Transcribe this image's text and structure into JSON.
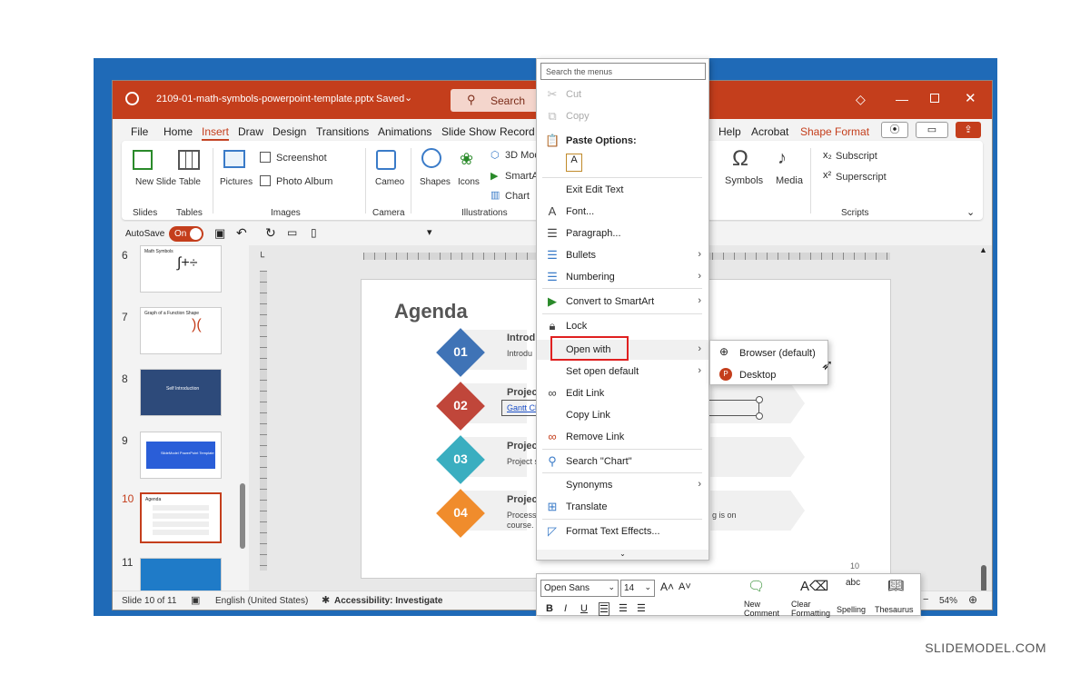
{
  "window": {
    "filename": "2109-01-math-symbols-powerpoint-template.pptx",
    "saved": "Saved",
    "search_label": "Search"
  },
  "tabs": [
    "File",
    "Home",
    "Insert",
    "Draw",
    "Design",
    "Transitions",
    "Animations",
    "Slide Show",
    "Record",
    "Help",
    "Acrobat",
    "Shape Format"
  ],
  "active_tab": "Insert",
  "ribbon": {
    "new_slide": "New Slide",
    "table": "Table",
    "pictures": "Pictures",
    "screenshot": "Screenshot",
    "photo_album": "Photo Album",
    "cameo": "Cameo",
    "shapes": "Shapes",
    "icons": "Icons",
    "models_3d": "3D Model",
    "smartart": "SmartArt",
    "chart": "Chart",
    "symbols": "Symbols",
    "media": "Media",
    "subscript": "Subscript",
    "superscript": "Superscript",
    "groups": {
      "slides": "Slides",
      "tables": "Tables",
      "images": "Images",
      "camera": "Camera",
      "illustrations": "Illustrations",
      "scripts": "Scripts"
    }
  },
  "qat": {
    "autosave": "AutoSave",
    "toggle": "On"
  },
  "thumbnails": [
    {
      "num": "6",
      "title": "Math Symbols"
    },
    {
      "num": "7",
      "title": "Graph of a Function Shape"
    },
    {
      "num": "8",
      "title": "Self Introduction"
    },
    {
      "num": "9",
      "title": "SlideModel PowerPoint Template"
    },
    {
      "num": "10",
      "title": "Agenda"
    },
    {
      "num": "11",
      "title": ""
    }
  ],
  "slide": {
    "title": "Agenda",
    "items": [
      {
        "num": "01",
        "heading": "Introd",
        "sub": "Introdu",
        "color": "#3f73b6"
      },
      {
        "num": "02",
        "heading": "Project",
        "sub": "Gantt Ch",
        "color": "#c0463a"
      },
      {
        "num": "03",
        "heading": "Project",
        "sub": "Project s",
        "color": "#3aaec0"
      },
      {
        "num": "04",
        "heading": "Project",
        "sub": "Process",
        "sub2": "course.",
        "tail": "g is on",
        "color": "#f08c2c"
      }
    ],
    "page_number": "10"
  },
  "context_menu": {
    "search_placeholder": "Search the menus",
    "cut": "Cut",
    "copy": "Copy",
    "paste_options": "Paste Options:",
    "exit_edit_text": "Exit Edit Text",
    "font": "Font...",
    "paragraph": "Paragraph...",
    "bullets": "Bullets",
    "numbering": "Numbering",
    "convert_smartart": "Convert to SmartArt",
    "lock": "Lock",
    "open_with": "Open with",
    "set_open_default": "Set open default",
    "edit_link": "Edit Link",
    "copy_link": "Copy Link",
    "remove_link": "Remove Link",
    "search_chart": "Search \"Chart\"",
    "synonyms": "Synonyms",
    "translate": "Translate",
    "format_text_effects": "Format Text Effects..."
  },
  "submenu": {
    "browser": "Browser (default)",
    "desktop": "Desktop"
  },
  "mini_toolbar": {
    "font_name": "Open Sans",
    "font_size": "14",
    "new_comment": "New Comment",
    "clear_formatting": "Clear Formatting",
    "spelling": "Spelling",
    "thesaurus": "Thesaurus"
  },
  "status": {
    "slide_of": "Slide 10 of 11",
    "language": "English (United States)",
    "accessibility": "Accessibility: Investigate",
    "zoom": "54%"
  },
  "watermark": "SLIDEMODEL.COM",
  "colors": {
    "accent": "#c43e1c",
    "frame": "#1f6ab7"
  }
}
